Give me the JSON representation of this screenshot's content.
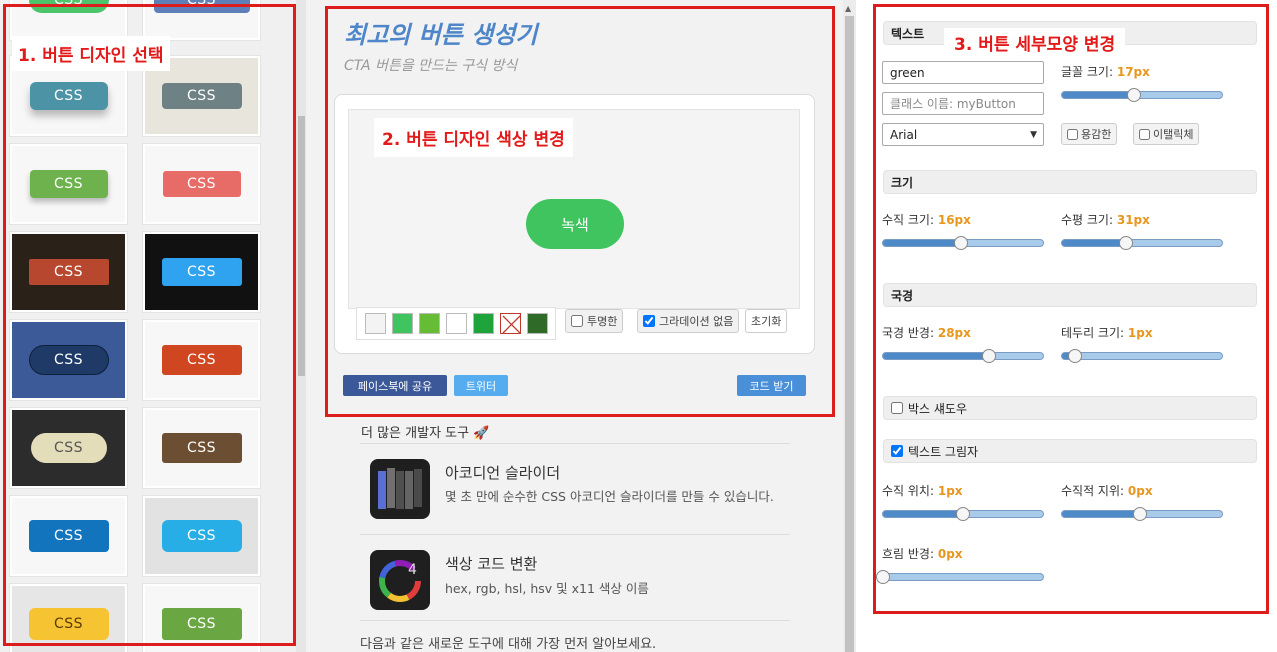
{
  "annotations": {
    "step1": "1. 버튼 디자인 선택",
    "step2": "2. 버튼 디자인 색상 변경",
    "step3": "3. 버튼 세부모양 변경"
  },
  "gallery": {
    "tile_label": "CSS",
    "colors": {
      "r0l": "#4cc56a",
      "r0r": "#5f7fba",
      "r1l": "#4d93a6",
      "r1r": "#6e8285",
      "r2l": "#6db24c",
      "r2r": "#e76c68",
      "r3l": "#b7472f",
      "r3r": "#2fa2f0",
      "r4l": "#1f3a67",
      "r4r": "#cf4620",
      "r5l": "#e4ddb9",
      "r5r": "#6c4e33",
      "r6l": "#1174bd",
      "r6r": "#27aee7",
      "r7l": "#f6c433",
      "r7r": "#6aa743"
    }
  },
  "generator": {
    "title": "최고의 버튼 생성기",
    "subtitle": "CTA 버튼을 만드는 구식 방식",
    "preview_button": "녹색",
    "preview_color": "#3fc45f",
    "swatches": [
      "#f3f3f3",
      "#3fc45f",
      "#66bd35",
      "#ffffff",
      "#1ea43b",
      "none",
      "#2f6a29"
    ],
    "transparent_label": "투명한",
    "no_gradient_label": "그라데이션 없음",
    "reset_label": "초기화",
    "share_facebook": "페이스북에 공유",
    "share_twitter": "트위터",
    "get_code": "코드 받기"
  },
  "more_tools": {
    "title": "더 많은 개발자 도구 🚀",
    "items": [
      {
        "name": "아코디언 슬라이더",
        "desc": "몇 초 만에 순수한 CSS 아코디언 슬라이더를 만들 수 있습니다."
      },
      {
        "name": "색상 코드 변환",
        "desc": "hex, rgb, hsl, hsv 및 x11 색상 이름"
      }
    ],
    "newsletter": "다음과 같은 새로운 도구에 대해 가장 먼저 알아보세요."
  },
  "settings": {
    "text_section": "텍스트",
    "text_value": "green",
    "class_placeholder": "클래스 이름: myButton",
    "font_value": "Arial",
    "bold_label": "용감한",
    "italic_label": "이탤릭체",
    "font_size_label": "글꼴 크기:",
    "font_size_value": "17px",
    "size_section": "크기",
    "vsize_label": "수직 크기:",
    "vsize_value": "16px",
    "hsize_label": "수평 크기:",
    "hsize_value": "31px",
    "border_section": "국경",
    "radius_label": "국경 반경:",
    "radius_value": "28px",
    "bwidth_label": "테두리 크기:",
    "bwidth_value": "1px",
    "box_shadow_section": "박스 섀도우",
    "text_shadow_section": "텍스트 그림자",
    "vpos_label": "수직 위치:",
    "vpos_value": "1px",
    "vpos2_label": "수직적 지위:",
    "vpos2_value": "0px",
    "blur_label": "흐림 반경:",
    "blur_value": "0px"
  },
  "slider_levels": {
    "font_size": 0.45,
    "vsize": 0.49,
    "hsize": 0.4,
    "radius": 0.66,
    "bwidth": 0.08,
    "vpos": 0.5,
    "vpos2": 0.49,
    "blur": 0.0
  }
}
